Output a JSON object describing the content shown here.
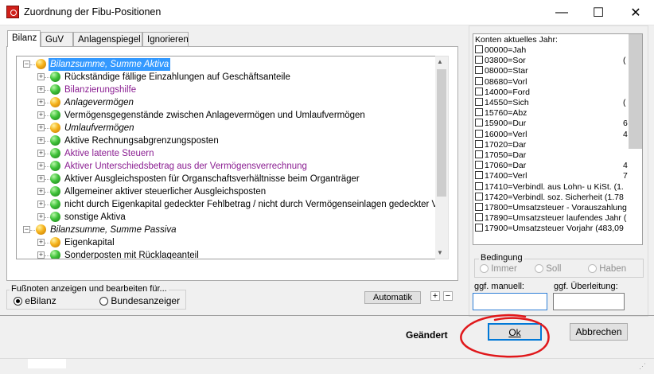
{
  "window": {
    "title": "Zuordnung der Fibu-Positionen",
    "minimize": "—",
    "maximize": "☐",
    "close": "✕"
  },
  "tabs": [
    {
      "label": "Bilanz",
      "active": true
    },
    {
      "label": "GuV",
      "active": false
    },
    {
      "label": "Anlagenspiegel",
      "active": false
    },
    {
      "label": "Ignorieren",
      "active": false
    }
  ],
  "tree": [
    {
      "text": "Bilanzsumme, Summe Aktiva",
      "level": 0,
      "ball": "orange",
      "style": "selected"
    },
    {
      "text": "Rückständige fällige Einzahlungen auf Geschäftsanteile",
      "level": 1,
      "ball": "green",
      "style": "normal"
    },
    {
      "text": "Bilanzierungshilfe",
      "level": 1,
      "ball": "green",
      "style": "purple"
    },
    {
      "text": "Anlagevermögen",
      "level": 1,
      "ball": "orange",
      "style": "italic"
    },
    {
      "text": "Vermögensgegenstände zwischen Anlagevermögen und Umlaufvermögen",
      "level": 1,
      "ball": "green",
      "style": "normal"
    },
    {
      "text": "Umlaufvermögen",
      "level": 1,
      "ball": "orange",
      "style": "italic"
    },
    {
      "text": "Aktive Rechnungsabgrenzungsposten",
      "level": 1,
      "ball": "green",
      "style": "normal"
    },
    {
      "text": "Aktive latente Steuern",
      "level": 1,
      "ball": "green",
      "style": "purple"
    },
    {
      "text": "Aktiver Unterschiedsbetrag aus der Vermögensverrechnung",
      "level": 1,
      "ball": "green",
      "style": "purple"
    },
    {
      "text": "Aktiver Ausgleichsposten für Organschaftsverhältnisse beim Organträger",
      "level": 1,
      "ball": "green",
      "style": "normal"
    },
    {
      "text": "Allgemeiner aktiver steuerlicher Ausgleichsposten",
      "level": 1,
      "ball": "green",
      "style": "normal"
    },
    {
      "text": "nicht durch Eigenkapital gedeckter Fehlbetrag / nicht durch Vermögenseinlagen gedeckter Verlus",
      "level": 1,
      "ball": "green",
      "style": "normal"
    },
    {
      "text": "sonstige Aktiva",
      "level": 1,
      "ball": "green",
      "style": "normal"
    },
    {
      "text": "Bilanzsumme, Summe Passiva",
      "level": 0,
      "ball": "orange",
      "style": "italic"
    },
    {
      "text": "Eigenkapital",
      "level": 1,
      "ball": "orange",
      "style": "normal"
    },
    {
      "text": "Sonderposten mit Rücklageanteil",
      "level": 1,
      "ball": "green",
      "style": "normal"
    }
  ],
  "footnotes": {
    "legend": "Fußnoten anzeigen und bearbeiten für...",
    "option1": "eBilanz",
    "option2": "Bundesanzeiger"
  },
  "automatik_label": "Automatik",
  "plus": "+",
  "minus": "−",
  "accounts": {
    "header": "Konten aktuelles Jahr:",
    "items": [
      "00000=Jah",
      "03800=Sor",
      "08000=Star",
      "08680=Vorl",
      "14000=Ford",
      "14550=Sich",
      "15760=Abz",
      "15900=Dur",
      "16000=Verl",
      "17020=Dar",
      "17050=Dar",
      "17060=Dar",
      "17400=Verl",
      "17410=Verbindl. aus Lohn- u KiSt. (1.",
      "17420=Verbindl. soz. Sicherheit (1.78",
      "17800=Umsatzsteuer - Vorauszahlung",
      "17890=Umsatzsteuer laufendes Jahr (",
      "17900=Umsatzsteuer Vorjahr (483,09"
    ],
    "tails": [
      "",
      "(",
      "",
      "",
      "",
      "(",
      "",
      "6",
      "4",
      "",
      "",
      "4",
      "7",
      "",
      "",
      "",
      "",
      ""
    ]
  },
  "bedingung": {
    "legend": "Bedingung",
    "opt1": "Immer",
    "opt2": "Soll",
    "opt3": "Haben"
  },
  "manuell_label": "ggf. manuell:",
  "ueberleitung_label": "ggf. Überleitung:",
  "status": "Geändert",
  "ok_label": "Ok",
  "cancel_label": "Abbrechen",
  "colors": {
    "selection": "#3399ff",
    "purple": "#8a1d91",
    "annotation": "#e0181b"
  }
}
